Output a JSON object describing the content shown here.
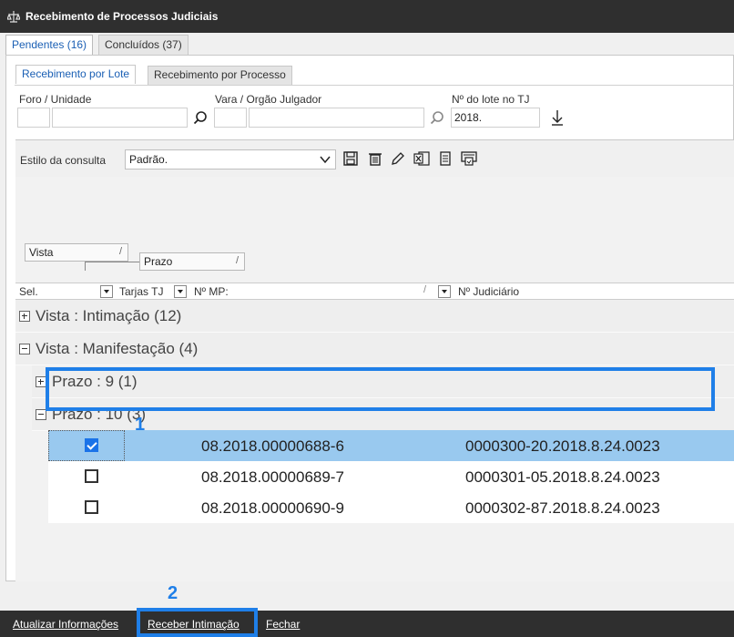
{
  "window": {
    "title": "Recebimento de Processos Judiciais",
    "app_icon": "scales-icon"
  },
  "outer_tabs": [
    {
      "label": "Pendentes (16)",
      "active": true
    },
    {
      "label": "Concluídos (37)",
      "active": false
    }
  ],
  "inner_tabs": [
    {
      "label": "Recebimento por Lote",
      "active": true
    },
    {
      "label": "Recebimento por Processo",
      "active": false
    }
  ],
  "filters": {
    "foro_label": "Foro / Unidade",
    "foro_code": "",
    "foro_name": "",
    "vara_label": "Vara / Orgão Julgador",
    "vara_code": "",
    "vara_name": "",
    "lote_label": "Nº do lote no TJ",
    "lote_value": "2018."
  },
  "consulta": {
    "label": "Estilo da consulta",
    "value": "Padrão."
  },
  "grouping": [
    {
      "label": "Vista"
    },
    {
      "label": "Prazo"
    }
  ],
  "columns": {
    "sel": "Sel.",
    "tarjas": "Tarjas TJ",
    "mp": "Nº MP:",
    "judiciario": "Nº Judiciário"
  },
  "groups": [
    {
      "label": "Vista : Intimação (12)",
      "expanded": false
    },
    {
      "label": "Vista : Manifestação (4)",
      "expanded": true
    },
    {
      "label": "Prazo : 9 (1)",
      "expanded": false
    },
    {
      "label": "Prazo : 10 (3)",
      "expanded": true
    }
  ],
  "rows": [
    {
      "checked": true,
      "mp": "08.2018.00000688-6",
      "judiciario": "0000300-20.2018.8.24.0023"
    },
    {
      "checked": false,
      "mp": "08.2018.00000689-7",
      "judiciario": "0000301-05.2018.8.24.0023"
    },
    {
      "checked": false,
      "mp": "08.2018.00000690-9",
      "judiciario": "0000302-87.2018.8.24.0023"
    }
  ],
  "annotations": {
    "step1": "1",
    "step2": "2",
    "highlight_color": "#1f7fe8"
  },
  "footer": {
    "atualizar": "Atualizar Informações",
    "receber": "Receber Intimação",
    "fechar": "Fechar"
  }
}
